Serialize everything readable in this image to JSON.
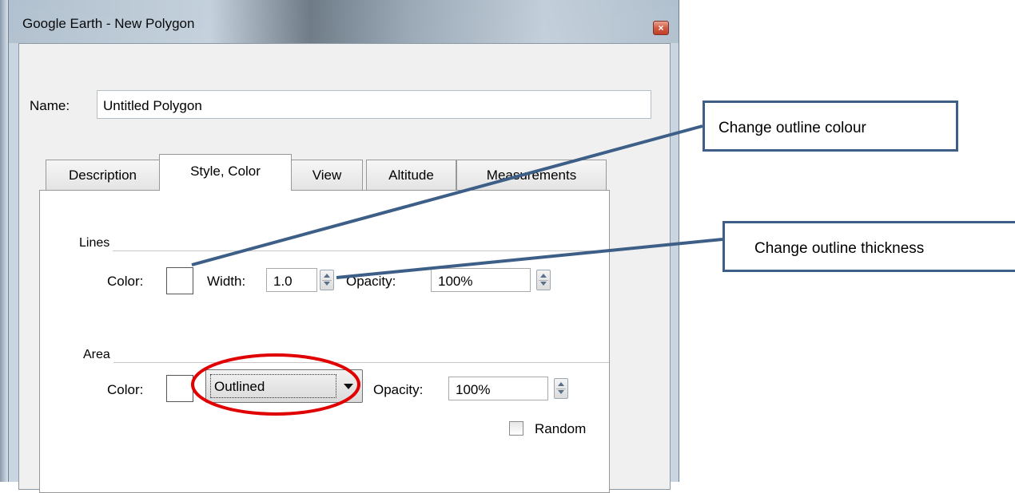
{
  "window": {
    "title": "Google Earth - New Polygon",
    "close_label": "×"
  },
  "name_field": {
    "label": "Name:",
    "value": "Untitled Polygon"
  },
  "tabs": [
    {
      "label": "Description",
      "active": false
    },
    {
      "label": "Style, Color",
      "active": true
    },
    {
      "label": "View",
      "active": false
    },
    {
      "label": "Altitude",
      "active": false
    },
    {
      "label": "Measurements",
      "active": false
    }
  ],
  "lines": {
    "group_label": "Lines",
    "color_label": "Color:",
    "width_label": "Width:",
    "width_value": "1.0",
    "opacity_label": "Opacity:",
    "opacity_value": "100%"
  },
  "area": {
    "group_label": "Area",
    "color_label": "Color:",
    "fill_mode_selected": "Outlined",
    "opacity_label": "Opacity:",
    "opacity_value": "100%",
    "random_label": "Random",
    "random_checked": false
  },
  "annotations": {
    "outline_colour": "Change outline colour",
    "outline_thickness": "Change outline thickness",
    "callout_border_color": "#3d5f87",
    "highlight_color": "#e00000"
  }
}
